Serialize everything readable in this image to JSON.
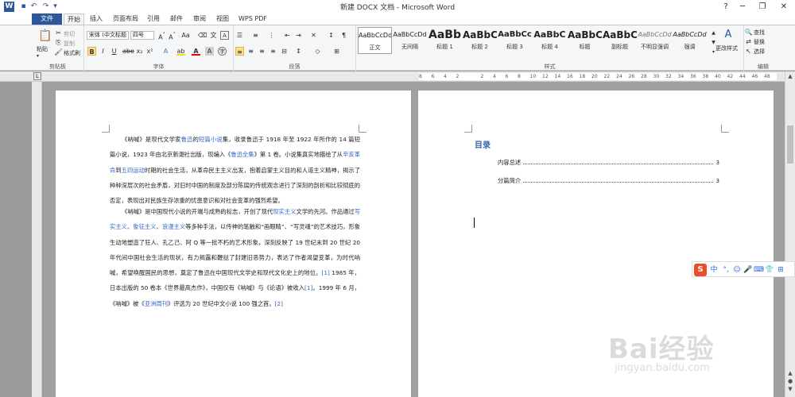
{
  "window": {
    "title": "新建 DOCX 文档 - Microsoft Word"
  },
  "quick_access": [
    "save-icon",
    "undo-icon",
    "redo-icon",
    "customize-icon"
  ],
  "tabs": [
    "文件",
    "开始",
    "插入",
    "页面布局",
    "引用",
    "邮件",
    "审阅",
    "视图",
    "WPS PDF"
  ],
  "clipboard": {
    "paste": "粘贴",
    "cut": "剪切",
    "copy": "复制",
    "format_painter": "格式刷",
    "label": "剪贴板"
  },
  "font": {
    "name": "宋体 (中文标题",
    "size": "四号",
    "label": "字体"
  },
  "paragraph": {
    "label": "段落"
  },
  "styles": {
    "label": "样式",
    "items": [
      {
        "preview": "AaBbCcDd",
        "name": "正文"
      },
      {
        "preview": "AaBbCcDd",
        "name": "无间隔"
      },
      {
        "preview": "AaBb",
        "name": "标题 1"
      },
      {
        "preview": "AaBbC",
        "name": "标题 2"
      },
      {
        "preview": "AaBbCc",
        "name": "标题 3"
      },
      {
        "preview": "AaBbC",
        "name": "标题 4"
      },
      {
        "preview": "AaBbC",
        "name": "标题"
      },
      {
        "preview": "AaBbC",
        "name": "副标题"
      },
      {
        "preview": "AaBbCcDd",
        "name": "不明显强调"
      },
      {
        "preview": "AaBbCcDd",
        "name": "强调"
      }
    ],
    "change_styles": "更改样式"
  },
  "editing": {
    "find": "查找",
    "replace": "替换",
    "select": "选择",
    "label": "编辑"
  },
  "ruler_ticks": [
    "8",
    "6",
    "4",
    "2",
    "",
    "2",
    "4",
    "6",
    "8",
    "10",
    "12",
    "14",
    "16",
    "18",
    "20",
    "22",
    "24",
    "26",
    "28",
    "30",
    "32",
    "34",
    "36",
    "38",
    "40",
    "42",
    "44",
    "46",
    "48"
  ],
  "page1": {
    "para1": [
      {
        "t": "《呐喊》是现代文学家"
      },
      {
        "t": "鲁迅",
        "link": true
      },
      {
        "t": "的"
      },
      {
        "t": "短篇小说",
        "link": true
      },
      {
        "t": "集，收录鲁迅于 1918 年至 1922 年所作的 14 篇短篇小说，1923 年由北京新潮社出版，现编入《"
      },
      {
        "t": "鲁迅全集",
        "link": true
      },
      {
        "t": "》第 1 卷。小说集真实地描绘了从"
      },
      {
        "t": "辛亥革命",
        "link": true
      },
      {
        "t": "到"
      },
      {
        "t": "五四运动",
        "link": true
      },
      {
        "t": "时期的社会生活，从革命民主主义出发，抱着启蒙主义目的和人道主义精神，揭示了种种深层次的社会矛盾，对旧时中国的制度及部分陈腐的传统观念进行了深刻的剖析和比较彻底的否定，表现出对民族生存浓重的忧患意识和对社会变革的强烈希望。"
      }
    ],
    "para2": [
      {
        "t": "《呐喊》是中国现代小说的开端与成熟的标志，开创了现代"
      },
      {
        "t": "现实主义",
        "link": true
      },
      {
        "t": "文学的先河。作品通过"
      },
      {
        "t": "写实主义",
        "link": true
      },
      {
        "t": "、"
      },
      {
        "t": "象征主义",
        "link": true
      },
      {
        "t": "、"
      },
      {
        "t": "浪漫主义",
        "link": true
      },
      {
        "t": "等多种手法，以传神的笔触和“画眼睛”、“写灵魂”的艺术技巧，形象生动地塑造了狂人、孔乙己、阿 Q 等一批不朽的艺术形象，深刻反映了 19 世纪末到 20 世纪 20 年代间中国社会生活的现状，有力揭露和鞭挞了封建旧恶势力，表达了作者渴望变革，为时代呐喊，希望唤醒国民的思想，奠定了鲁迅在中国现代文学史和现代文化史上的地位。"
      },
      {
        "t": "[1]",
        "link": true
      },
      {
        "t": " 1985 年，日本出版的 50 卷本《世界最高杰作》，中国仅有《呐喊》与《论语》被收入"
      },
      {
        "t": "[1]",
        "link": true
      },
      {
        "t": "。1999 年 6 月，《呐喊》被《"
      },
      {
        "t": "亚洲周刊",
        "link": true
      },
      {
        "t": "》评选为 20 世纪中文小说 100 强之首。"
      },
      {
        "t": "[2]",
        "link": true
      }
    ]
  },
  "page2": {
    "toc_title": "目录",
    "toc": [
      {
        "label": "内容总述",
        "page": "3"
      },
      {
        "label": "分篇简介",
        "page": "3"
      }
    ]
  },
  "ime": {
    "label": "S",
    "items": [
      "中",
      "°,",
      "☺",
      "🎤",
      "⌨",
      "👕",
      "⊞"
    ]
  },
  "watermark": {
    "brand": "Bai经验",
    "url": "jingyan.baidu.com"
  },
  "colors": {
    "file_tab": "#2b579a",
    "link": "#3366cc",
    "toc_title": "#3367b0",
    "ime": "#e8502a"
  }
}
